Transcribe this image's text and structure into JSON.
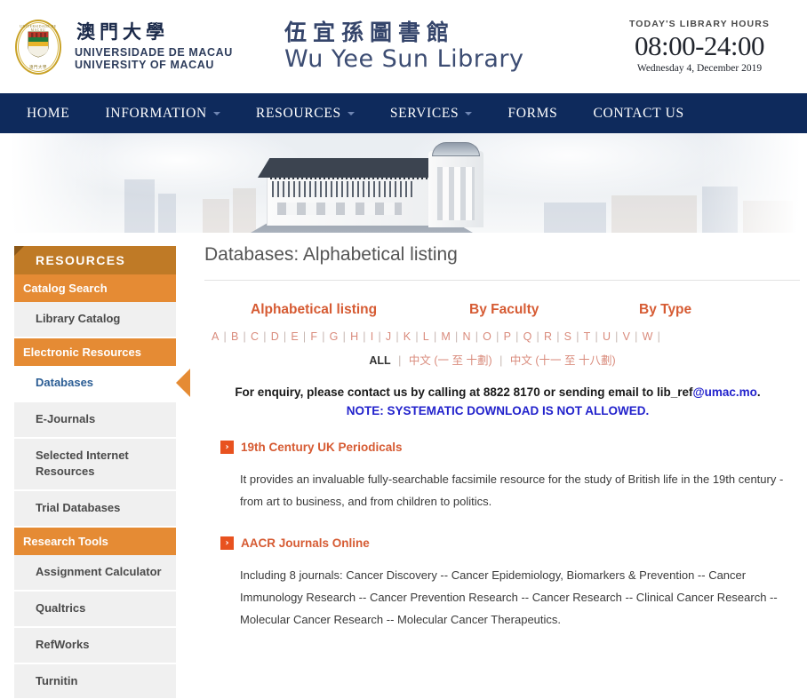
{
  "header": {
    "crest": {
      "ring_text_top": "UNIVERSIDADE DE MACAU",
      "ring_text_bottom": "澳門大學"
    },
    "brand": {
      "cn": "澳門大學",
      "pt": "UNIVERSIDADE DE MACAU",
      "en": "UNIVERSITY OF MACAU"
    },
    "library": {
      "cn": "伍宜孫圖書館",
      "en": "Wu Yee Sun Library"
    },
    "hours": {
      "label": "TODAY'S LIBRARY HOURS",
      "time": "08:00-24:00",
      "date": "Wednesday 4, December 2019"
    }
  },
  "nav": {
    "items": [
      {
        "label": "HOME",
        "has_caret": false
      },
      {
        "label": "INFORMATION",
        "has_caret": true
      },
      {
        "label": "RESOURCES",
        "has_caret": true
      },
      {
        "label": "SERVICES",
        "has_caret": true
      },
      {
        "label": "FORMS",
        "has_caret": false
      },
      {
        "label": "CONTACT US",
        "has_caret": false
      }
    ]
  },
  "sidebar": {
    "title": "RESOURCES",
    "groups": [
      {
        "label": "Catalog Search",
        "items": [
          {
            "label": "Library Catalog",
            "active": false
          }
        ]
      },
      {
        "label": "Electronic Resources",
        "items": [
          {
            "label": "Databases",
            "active": true
          },
          {
            "label": "E-Journals",
            "active": false
          },
          {
            "label": "Selected Internet Resources",
            "active": false
          },
          {
            "label": "Trial Databases",
            "active": false
          }
        ]
      },
      {
        "label": "Research Tools",
        "items": [
          {
            "label": "Assignment Calculator",
            "active": false
          },
          {
            "label": "Qualtrics",
            "active": false
          },
          {
            "label": "RefWorks",
            "active": false
          },
          {
            "label": "Turnitin",
            "active": false
          }
        ]
      }
    ]
  },
  "main": {
    "page_title": "Databases: Alphabetical listing",
    "tabs": [
      {
        "label": "Alphabetical listing"
      },
      {
        "label": "By Faculty"
      },
      {
        "label": "By Type"
      }
    ],
    "alphabet": [
      "A",
      "B",
      "C",
      "D",
      "E",
      "F",
      "G",
      "H",
      "I",
      "J",
      "K",
      "L",
      "M",
      "N",
      "O",
      "P",
      "Q",
      "R",
      "S",
      "T",
      "U",
      "V",
      "W"
    ],
    "alphabet_separator": "|",
    "secondary_links": {
      "all": "ALL",
      "links": [
        "中文 (一 至 十劃)",
        "中文 (十一 至 十八劃)"
      ]
    },
    "enquiry": {
      "prefix": "For enquiry, please contact us by calling at 8822 8170 or sending email to ",
      "email_plain": "lib_ref",
      "email_link": "@umac.mo",
      "suffix": ".",
      "note": "NOTE: SYSTEMATIC DOWNLOAD IS NOT ALLOWED."
    },
    "databases": [
      {
        "bullet": "›",
        "title": "19th Century UK Periodicals",
        "description": "It provides an invaluable fully-searchable facsimile resource for the study of British life in the 19th century - from art to business, and from children to politics."
      },
      {
        "bullet": "›",
        "title": "AACR Journals Online",
        "description": "Including 8 journals: Cancer Discovery -- Cancer Epidemiology, Biomarkers & Prevention -- Cancer Immunology Research -- Cancer Prevention Research -- Cancer Research -- Clinical Cancer Research -- Molecular Cancer Research -- Molecular Cancer Therapeutics."
      }
    ]
  },
  "colors": {
    "nav_bg": "#0e2a5c",
    "sidebar_header": "#bf7a26",
    "sidebar_group": "#e58b34",
    "accent_orange": "#d65b33",
    "bullet": "#e8521f",
    "link_blue": "#2222cc",
    "active_blue": "#2b5d94",
    "alphabet": "#d98b7c"
  }
}
